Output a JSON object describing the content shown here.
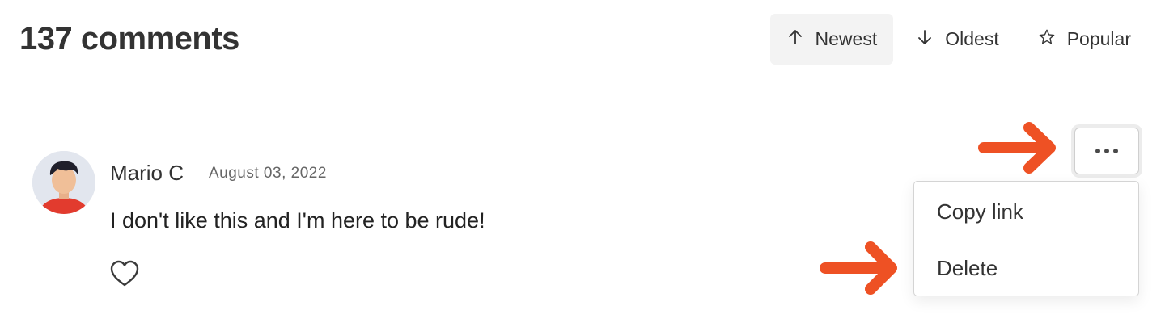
{
  "header": {
    "comment_count": "137 comments"
  },
  "sort": {
    "options": [
      {
        "label": "Newest",
        "icon": "arrow-up-icon",
        "active": true
      },
      {
        "label": "Oldest",
        "icon": "arrow-down-icon",
        "active": false
      },
      {
        "label": "Popular",
        "icon": "star-icon",
        "active": false
      }
    ]
  },
  "comment": {
    "author": "Mario C",
    "date": "August 03, 2022",
    "text": "I don't like this and I'm here to be rude!",
    "like_icon": "heart-icon"
  },
  "menu": {
    "trigger_icon": "more-icon",
    "items": [
      "Copy link",
      "Delete"
    ]
  },
  "colors": {
    "annotation_arrow": "#ee5124",
    "active_sort_bg": "#f3f3f3"
  }
}
